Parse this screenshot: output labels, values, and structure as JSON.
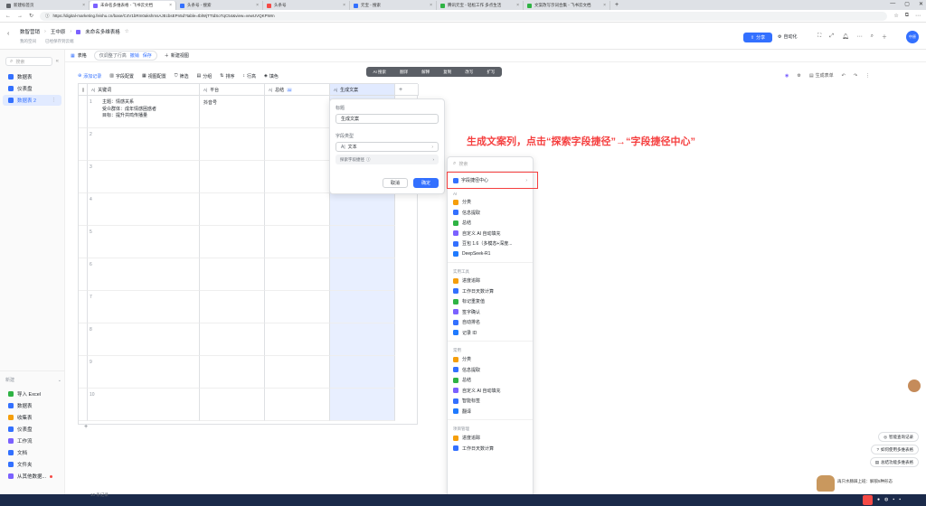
{
  "browser": {
    "tabs": [
      {
        "label": "新建标签页",
        "icon": "doc-tab-icon",
        "color": "#5f6368"
      },
      {
        "label": "未命名多维表格 - 飞书云文档",
        "icon": "bitable-tab-icon",
        "color": "#7b61ff",
        "active": true
      },
      {
        "label": "头条号 - 搜索",
        "icon": "search-tab-icon",
        "color": "#3370ff"
      },
      {
        "label": "头条号",
        "icon": "toutiao-tab-icon",
        "color": "#f54a45"
      },
      {
        "label": "元宝 - 搜索",
        "icon": "search-tab-icon",
        "color": "#3370ff"
      },
      {
        "label": "腾讯元宝 - 轻松工作 多点生活",
        "icon": "yuanbao-tab-icon",
        "color": "#2fb344"
      },
      {
        "label": "文案改写示词合集 - 飞书云文档",
        "icon": "docs-tab-icon",
        "color": "#2fb344"
      }
    ],
    "url": "https://digital-marketing.feishu.cn/base/C4V1bRm0akshmsAJEcbsEPn5d?table=tblWjTTtdSoTqC54&view=vewUVQKPWm"
  },
  "app_header": {
    "breadcrumb_parent": "数智营销",
    "breadcrumb_sub": "王中原",
    "doc_title": "未命名多维表格",
    "sub_line1": "我的空间",
    "sub_line2": "已经保存到云端",
    "share_label": "分享",
    "automation_label": "自动化",
    "avatar_text": "中原"
  },
  "sidebar": {
    "search_placeholder": "搜索",
    "items": [
      {
        "label": "数据表",
        "color": "#3370ff"
      },
      {
        "label": "仪表盘",
        "color": "#3370ff"
      },
      {
        "label": "数据表 2",
        "color": "#3370ff",
        "active": true
      }
    ],
    "new_label": "新建",
    "bottom_items": [
      {
        "label": "导入 Excel",
        "color": "#2fb344"
      },
      {
        "label": "数据表",
        "color": "#3370ff"
      },
      {
        "label": "收集表",
        "color": "#f59e0b"
      },
      {
        "label": "仪表盘",
        "color": "#3370ff"
      },
      {
        "label": "工作流",
        "color": "#7b61ff"
      },
      {
        "label": "文档",
        "color": "#3370ff"
      },
      {
        "label": "文件夹",
        "color": "#3370ff"
      },
      {
        "label": "从其他数据...",
        "color": "#7b61ff"
      }
    ]
  },
  "tablebar": {
    "table_label": "表格",
    "view_hint": "仅调整了行高",
    "badge1": "撤销",
    "badge2": "保存",
    "new_view": "新建视图"
  },
  "toolbar": {
    "items": [
      "添加记录",
      "字段配置",
      "视图配置",
      "筛选",
      "分组",
      "排序",
      "行高",
      "填色"
    ],
    "right_item": "生成表单"
  },
  "floatbar": {
    "items": [
      "AI 搜索",
      "翻译",
      "解释",
      "复制",
      "改写",
      "扩写"
    ]
  },
  "grid": {
    "columns": [
      "关键词",
      "平台",
      "总结",
      "生成文案"
    ],
    "cell_r1_c1": [
      "主题：情感关系",
      "受众群体：成年情感困惑者",
      "目标：提升共鸣传播量"
    ],
    "cell_r1_c2": "抖音号",
    "row_numbers": [
      "1",
      "2",
      "3",
      "4",
      "5",
      "6",
      "7",
      "8",
      "9",
      "10"
    ],
    "footer": "10 条记录"
  },
  "field_panel": {
    "title_label": "标题",
    "title_value": "生成文案",
    "type_label": "字段类型",
    "type_value": "文本",
    "explore_label": "探索字段捷径",
    "cancel": "取消",
    "confirm": "确定"
  },
  "dropdown": {
    "search_placeholder": "搜索",
    "top_item": "字段捷径中心",
    "sections": [
      {
        "title": "AI",
        "items": [
          "分类",
          "信息提取",
          "总结",
          "自定义 AI 自动填充",
          "豆包 1.6（多模态+深度...",
          "DeepSeek-R1"
        ]
      },
      {
        "title": "实用工具",
        "items": [
          "进度追踪",
          "工作日天数计算",
          "标记重复值",
          "签字确认",
          "自动排名",
          "记录 ID"
        ]
      },
      {
        "title": "常用",
        "items": [
          "分类",
          "信息提取",
          "总结",
          "自定义 AI 自动填充",
          "智能标签",
          "翻译"
        ]
      },
      {
        "title": "项目管理",
        "items": [
          "进度追踪",
          "工作日天数计算"
        ]
      }
    ]
  },
  "annotation": "生成文案列，点击“探索字段捷径”→“字段捷径中心”",
  "right_buttons": [
    "智能查询记录",
    "如何使用多维表格",
    "总结功能多维表格"
  ],
  "mascot_text": "再只水豚踩上班：解锁5种形态"
}
